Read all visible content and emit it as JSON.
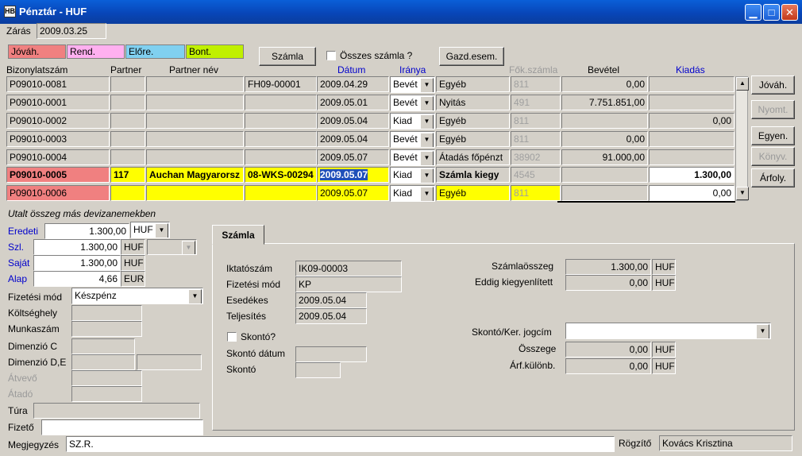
{
  "window": {
    "title": "Pénztár - HUF",
    "icon_text": "HB"
  },
  "header": {
    "zaras_label": "Zárás",
    "zaras_value": "2009.03.25"
  },
  "legend": [
    {
      "label": "Jóváh.",
      "color": "#f08080"
    },
    {
      "label": "Rend.",
      "color": "#ffb0f0"
    },
    {
      "label": "Előre.",
      "color": "#80d0f0"
    },
    {
      "label": "Bont.",
      "color": "#c0f000"
    }
  ],
  "toolbar": {
    "szamla_button": "Számla",
    "osszes_label": "Összes számla ?",
    "gazd_button": "Gazd.esem."
  },
  "grid": {
    "columns": {
      "bizonylatszam": "Bizonylatszám",
      "partner": "Partner",
      "partner_nev": "Partner név",
      "datum": "Dátum",
      "iranya": "Iránya",
      "fokszamla": "Fők.számla",
      "bevetel": "Bevétel",
      "kiadas": "Kiadás"
    },
    "rows": [
      {
        "szam": "P09010-0081",
        "partner": "",
        "nev": "",
        "ref": "FH09-00001",
        "datum": "2009.04.29",
        "irany": "Bevét",
        "jogcim": "Egyéb",
        "fok": "811",
        "bevetel": "0,00",
        "kiadas": ""
      },
      {
        "szam": "P09010-0001",
        "partner": "",
        "nev": "",
        "ref": "",
        "datum": "2009.05.01",
        "irany": "Bevét",
        "jogcim": "Nyitás",
        "fok": "491",
        "bevetel": "7.751.851,00",
        "kiadas": ""
      },
      {
        "szam": "P09010-0002",
        "partner": "",
        "nev": "",
        "ref": "",
        "datum": "2009.05.04",
        "irany": "Kiad",
        "jogcim": "Egyéb",
        "fok": "811",
        "bevetel": "",
        "kiadas": "0,00"
      },
      {
        "szam": "P09010-0003",
        "partner": "",
        "nev": "",
        "ref": "",
        "datum": "2009.05.04",
        "irany": "Bevét",
        "jogcim": "Egyéb",
        "fok": "811",
        "bevetel": "0,00",
        "kiadas": ""
      },
      {
        "szam": "P09010-0004",
        "partner": "",
        "nev": "",
        "ref": "",
        "datum": "2009.05.07",
        "irany": "Bevét",
        "jogcim": "Átadás főpénzt",
        "fok": "38902",
        "bevetel": "91.000,00",
        "kiadas": ""
      },
      {
        "szam": "P09010-0005",
        "partner": "117",
        "nev": "Auchan Magyarorsz",
        "ref": "08-WKS-00294",
        "datum": "2009.05.07",
        "irany": "Kiad",
        "jogcim": "Számla kiegy",
        "fok": "4545",
        "bevetel": "",
        "kiadas": "1.300,00"
      },
      {
        "szam": "P09010-0006",
        "partner": "",
        "nev": "",
        "ref": "",
        "datum": "2009.05.07",
        "irany": "Kiad",
        "jogcim": "Egyéb",
        "fok": "811",
        "bevetel": "",
        "kiadas": "0,00"
      }
    ]
  },
  "side_buttons": {
    "jovah": "Jóváh.",
    "nyomt": "Nyomt.",
    "egyen": "Egyen.",
    "konyv": "Könyv.",
    "arfoly": "Árfoly."
  },
  "currency": {
    "section_label": "Utalt összeg más devizanemekben",
    "eredeti_label": "Eredeti",
    "eredeti_value": "1.300,00",
    "eredeti_cur": "HUF",
    "szl_label": "Szl.",
    "szl_value": "1.300,00",
    "szl_cur": "HUF",
    "sajat_label": "Saját",
    "sajat_value": "1.300,00",
    "sajat_cur": "HUF",
    "alap_label": "Alap",
    "alap_value": "4,66",
    "alap_cur": "EUR"
  },
  "details": {
    "fizmod_label": "Fizetési mód",
    "fizmod_value": "Készpénz",
    "koltseghely_label": "Költséghely",
    "munkaszam_label": "Munkaszám",
    "dimc_label": "Dimenzió C",
    "dimde_label": "Dimenzió D,E",
    "atvevo_label": "Átvevő",
    "atado_label": "Átadó",
    "tura_label": "Túra",
    "fizeto_label": "Fizető",
    "megjegyzes_label": "Megjegyzés",
    "megjegyzes_value": "SZ.R.",
    "rogzito_label": "Rögzítő",
    "rogzito_value": "Kovács Krisztina"
  },
  "tab": {
    "label": "Számla",
    "iktatoszam_label": "Iktatószám",
    "iktatoszam_value": "IK09-00003",
    "fizmod_label": "Fizetési mód",
    "fizmod_value": "KP",
    "esedekes_label": "Esedékes",
    "esedekes_value": "2009.05.04",
    "teljesites_label": "Teljesítés",
    "teljesites_value": "2009.05.04",
    "skonto_q_label": "Skontó?",
    "skonto_datum_label": "Skontó dátum",
    "skonto_label": "Skontó",
    "szamlaosszeg_label": "Számlaösszeg",
    "szamlaosszeg_value": "1.300,00",
    "szamlaosszeg_cur": "HUF",
    "kiegyenlitett_label": "Eddig kiegyenlített",
    "kiegyenlitett_value": "0,00",
    "kiegyenlitett_cur": "HUF",
    "jogcim_label": "Skontó/Ker. jogcím",
    "osszege_label": "Összege",
    "osszege_value": "0,00",
    "osszege_cur": "HUF",
    "arfkul_label": "Árf.különb.",
    "arfkul_value": "0,00",
    "arfkul_cur": "HUF"
  }
}
